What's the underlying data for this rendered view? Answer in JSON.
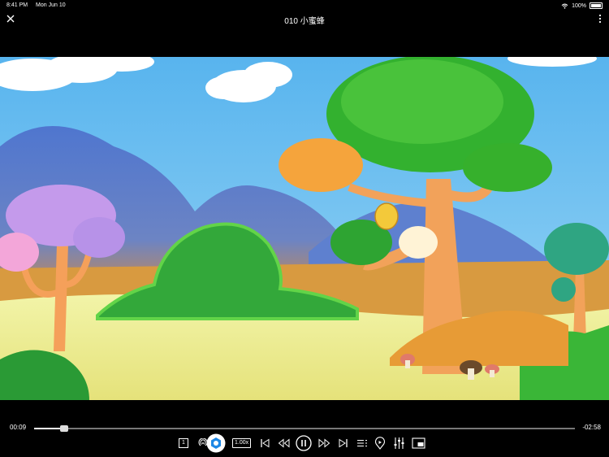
{
  "status_bar": {
    "time": "8:41 PM",
    "date": "Mon Jun 10",
    "battery": "100%",
    "icons": [
      "wifi-icon",
      "battery-icon"
    ]
  },
  "nav": {
    "title": "010 小蜜蜂",
    "icons": [
      "close-icon",
      "more-vertical-icon"
    ]
  },
  "player": {
    "elapsed": "00:09",
    "remaining": "-02:58",
    "progress": 0.055,
    "episode_label": "1",
    "speed_label": "1.00x",
    "accent_color": "#1e88e5"
  },
  "toolbar_icons": [
    "airplay-icon",
    "cast-icon",
    "previous-icon",
    "rewind-icon",
    "pause-icon",
    "fast-forward-icon",
    "next-icon",
    "playlist-icon",
    "location-icon",
    "equalizer-icon",
    "picture-in-picture-icon"
  ]
}
